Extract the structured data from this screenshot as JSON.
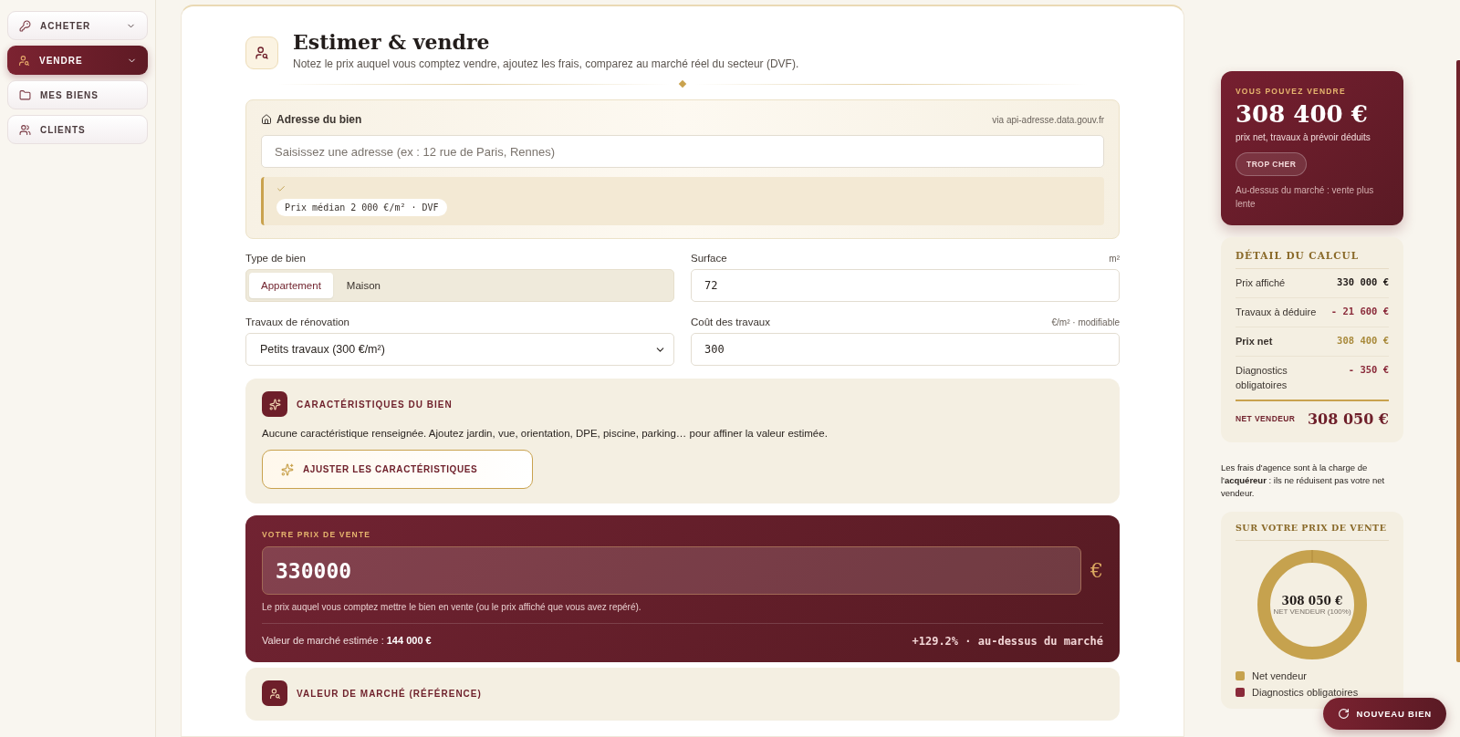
{
  "sidebar": {
    "items": [
      {
        "label": "ACHETER",
        "expandable": true,
        "selected": false
      },
      {
        "label": "VENDRE",
        "expandable": true,
        "selected": true
      },
      {
        "label": "MES BIENS",
        "expandable": false,
        "selected": false
      },
      {
        "label": "CLIENTS",
        "expandable": false,
        "selected": false
      }
    ]
  },
  "header": {
    "title": "Estimer & vendre",
    "subtitle": "Notez le prix auquel vous comptez vendre, ajoutez les frais, comparez au marché réel du secteur (DVF)."
  },
  "address": {
    "label": "Adresse du bien",
    "source": "via api-adresse.data.gouv.fr",
    "placeholder": "Saisissez une adresse (ex : 12 rue de Paris, Rennes)",
    "status": {
      "ok": true,
      "badge": "Prix médian 2 000 €/m² · DVF"
    }
  },
  "type_de_bien": {
    "label": "Type de bien",
    "options": [
      {
        "label": "Appartement",
        "selected": true
      },
      {
        "label": "Maison",
        "selected": false
      }
    ]
  },
  "surface": {
    "label": "Surface",
    "unit": "m²",
    "value": "72"
  },
  "travaux": {
    "label": "Travaux de rénovation",
    "value": "Petits travaux (300 €/m²)"
  },
  "cout_travaux": {
    "label": "Coût des travaux",
    "unit": "€/m² · modifiable",
    "value": "300"
  },
  "caracteristiques": {
    "title": "CARACTÉRISTIQUES DU BIEN",
    "text": "Aucune caractéristique renseignée. Ajoutez jardin, vue, orientation, DPE, piscine, parking… pour affiner la valeur estimée.",
    "button": "AJUSTER LES CARACTÉRISTIQUES"
  },
  "prix_vente": {
    "label": "VOTRE PRIX DE VENTE",
    "value": "330000",
    "currency": "€",
    "hint": "Le prix auquel vous comptez mettre le bien en vente (ou le prix affiché que vous avez repéré).",
    "market_label": "Valeur de marché estimée : **144 000 €**",
    "delta": "+129.2% · au-dessus du marché"
  },
  "valeur_marche": {
    "title": "VALEUR DE MARCHÉ (RÉFÉRENCE)"
  },
  "summary": {
    "eyebrow": "VOUS POUVEZ VENDRE",
    "amount": "308 400 €",
    "caption": "prix net, travaux à prévoir déduits",
    "verdict": "TROP CHER",
    "note": "Au-dessus du marché : vente plus lente"
  },
  "detail": {
    "title": "DÉTAIL DU CALCUL",
    "rows": [
      {
        "label": "Prix affiché",
        "value": "330 000 €",
        "kind": "plain"
      },
      {
        "label": "Travaux à déduire",
        "value": "- 21 600 €",
        "kind": "deduction"
      },
      {
        "label": "Prix net",
        "value": "308 400 €",
        "kind": "subtotal"
      },
      {
        "label": "Diagnostics obligatoires",
        "value": "- 350 €",
        "kind": "deduction"
      }
    ],
    "total_label": "NET VENDEUR",
    "total_value": "308 050 €"
  },
  "agency_note": "Les frais d'agence sont à la charge de l'**acquéreur** : ils ne réduisent pas votre net vendeur.",
  "breakdown": {
    "title": "SUR VOTRE PRIX DE VENTE",
    "center_value": "308 050 €",
    "center_label": "NET VENDEUR (100%)",
    "legend": [
      {
        "label": "Net vendeur",
        "color": "#c6a24e"
      },
      {
        "label": "Diagnostics obligatoires",
        "color": "#8a2a3a"
      }
    ]
  },
  "fab": {
    "label": "NOUVEAU BIEN"
  }
}
